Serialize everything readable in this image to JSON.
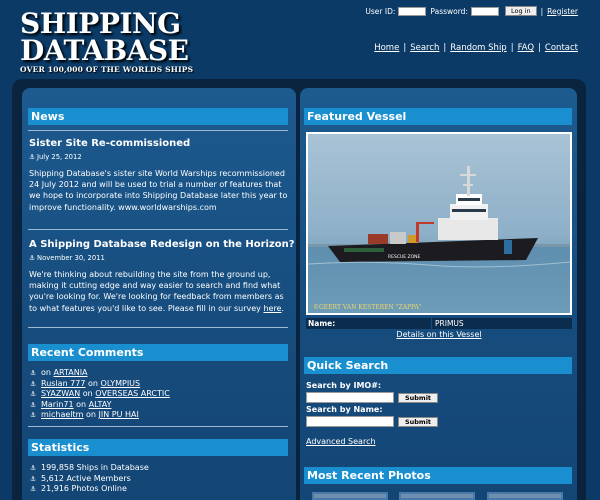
{
  "header": {
    "logo_line1": "SHIPPING",
    "logo_line2": "DATABASE",
    "logo_tagline": "OVER 100,000 OF THE WORLDS SHIPS",
    "user_id_label": "User ID:",
    "password_label": "Password:",
    "login_button": "Log in",
    "login_separator": "|",
    "register_link": "Register",
    "nav": [
      "Home",
      "Search",
      "Random Ship",
      "FAQ",
      "Contact"
    ],
    "nav_separator": "|"
  },
  "news": {
    "heading": "News",
    "items": [
      {
        "title": "Sister Site Re-commissioned",
        "date": "July 25, 2012",
        "body": "Shipping Database's sister site World Warships recommissioned 24 July 2012 and will be used to trial a number of features that we hope to incorporate into Shipping Database later this year to improve functionality. www.worldwarships.com"
      },
      {
        "title": "A Shipping Database Redesign on the Horizon?",
        "date": "November 30, 2011",
        "body": "We're thinking about rebuilding the site from the ground up, making it cutting edge and way easier to search and find what you're looking for. We're looking for feedback from members as to what features you'd like to see. Please fill in our survey ",
        "link": "here",
        "body_end": "."
      }
    ]
  },
  "recent_comments": {
    "heading": "Recent Comments",
    "connector": "on",
    "items": [
      {
        "author": "",
        "ship": "ARTANIA"
      },
      {
        "author": "Ruslan 777",
        "ship": "OLYMPIUS"
      },
      {
        "author": "SYAZWAN",
        "ship": "OVERSEAS ARCTIC"
      },
      {
        "author": "Marin71",
        "ship": "ALTAY"
      },
      {
        "author": "michaeltm",
        "ship": "JIN PU HAI"
      }
    ]
  },
  "statistics": {
    "heading": "Statistics",
    "items": [
      "199,858 Ships in Database",
      "5,612 Active Members",
      "21,916 Photos Online"
    ]
  },
  "featured_vessel": {
    "heading": "Featured Vessel",
    "photo_credit": "©GEERT VAN KESTEREN \"ZAPPA\"",
    "hull_text": "RESCUE ZONE",
    "name_label": "Name:",
    "name_value": "PRIMUS",
    "details_link": "Details on this Vessel"
  },
  "quick_search": {
    "heading": "Quick Search",
    "imo_label": "Search by IMO#:",
    "name_label": "Search by Name:",
    "submit_label": "Submit",
    "advanced_link": "Advanced Search"
  },
  "recent_photos": {
    "heading": "Most Recent Photos"
  },
  "icons": {
    "anchor": "⚓"
  }
}
